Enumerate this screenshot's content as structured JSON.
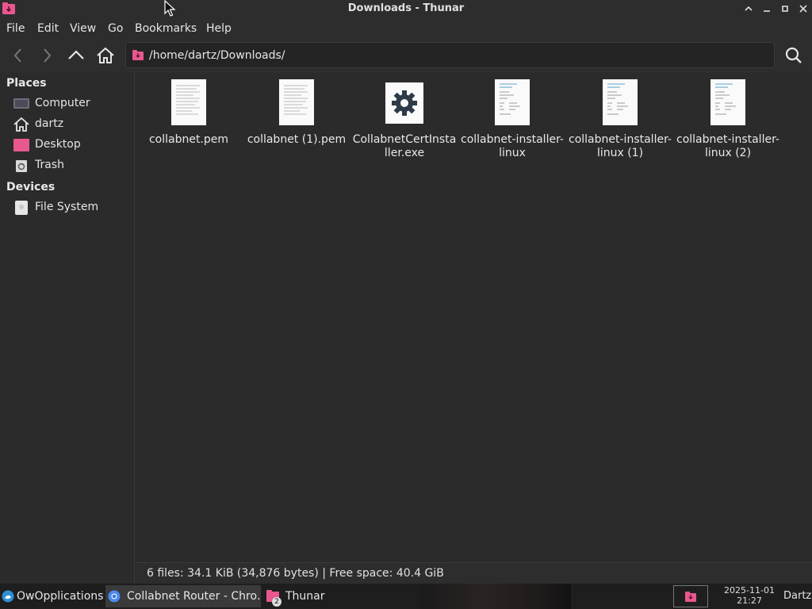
{
  "window": {
    "title": "Downloads - Thunar",
    "accent_color": "#e8588f"
  },
  "menu": {
    "items": [
      "File",
      "Edit",
      "View",
      "Go",
      "Bookmarks",
      "Help"
    ]
  },
  "toolbar": {
    "back_icon": "back-arrow-icon",
    "forward_icon": "forward-arrow-icon",
    "up_icon": "up-arrow-icon",
    "home_icon": "home-icon",
    "location": "/home/dartz/Downloads/",
    "search_icon": "search-icon"
  },
  "sidebar": {
    "places_header": "Places",
    "places": [
      {
        "label": "Computer",
        "icon": "computer-icon"
      },
      {
        "label": "dartz",
        "icon": "home-icon"
      },
      {
        "label": "Desktop",
        "icon": "desktop-folder-icon"
      },
      {
        "label": "Trash",
        "icon": "trash-icon"
      }
    ],
    "devices_header": "Devices",
    "devices": [
      {
        "label": "File System",
        "icon": "drive-icon"
      }
    ]
  },
  "files": [
    {
      "name": "collabnet.pem",
      "icon": "text-document-icon"
    },
    {
      "name": "collabnet (1).pem",
      "icon": "text-document-icon"
    },
    {
      "name": "CollabnetCertInstaller.exe",
      "icon": "gear-executable-icon"
    },
    {
      "name": "collabnet-installer-linux",
      "icon": "script-document-icon"
    },
    {
      "name": "collabnet-installer-linux (1)",
      "icon": "script-document-icon"
    },
    {
      "name": "collabnet-installer-linux (2)",
      "icon": "script-document-icon"
    }
  ],
  "status": {
    "text": "6 files: 34.1 KiB (34,876 bytes)  |  Free space: 40.4 GiB"
  },
  "taskbar": {
    "apps_menu": "OwOpplications",
    "tasks": [
      {
        "label": "Collabnet Router - Chro…",
        "icon": "chrome-icon"
      },
      {
        "label": "Thunar",
        "icon": "thunar-folder-icon",
        "badge": "2"
      }
    ],
    "clock_date": "2025-11-01",
    "clock_time": "21:27",
    "user": "Dartz"
  }
}
